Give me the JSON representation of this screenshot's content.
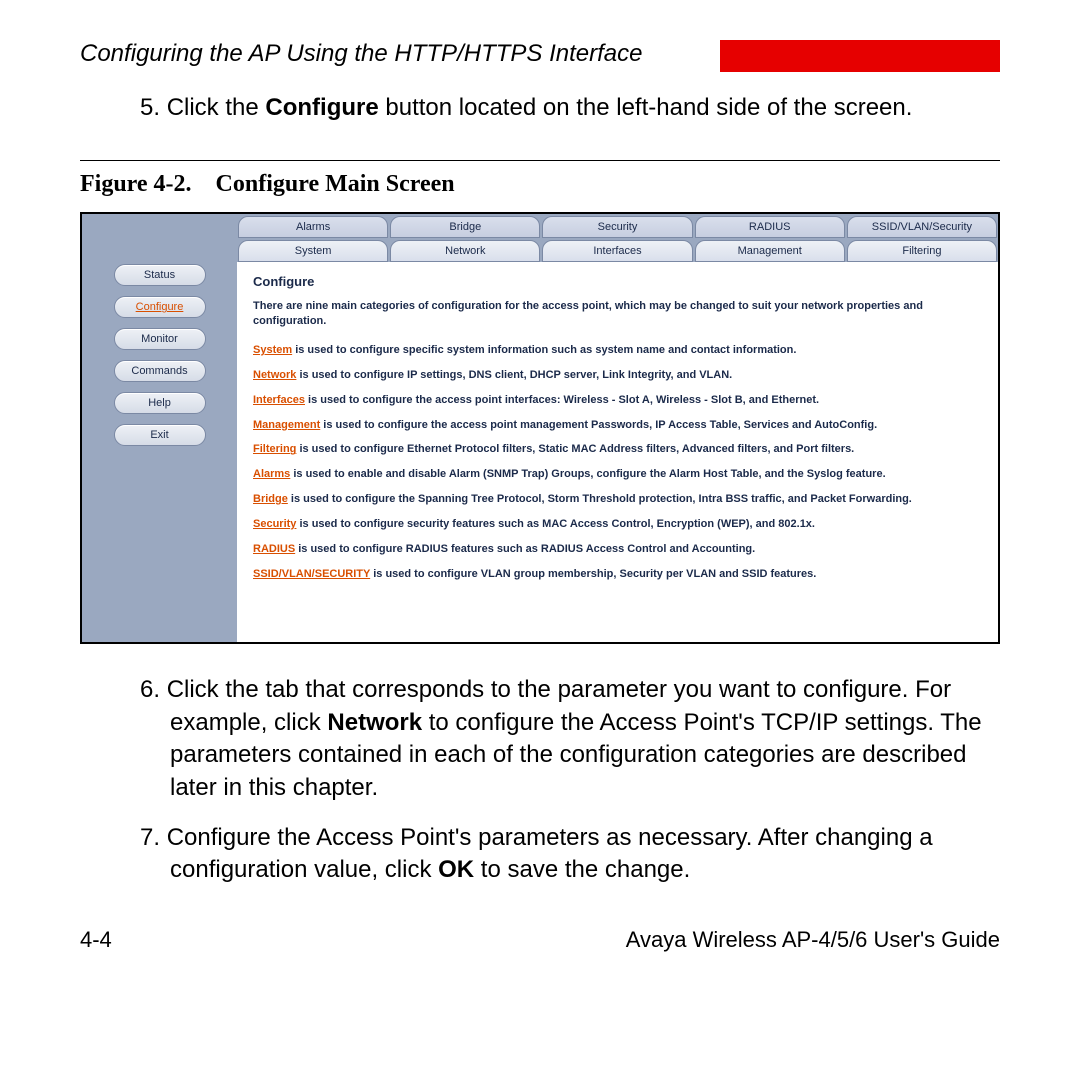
{
  "header": {
    "title": "Configuring the AP Using the HTTP/HTTPS Interface"
  },
  "steps": {
    "s5": {
      "num": "5.",
      "pre": "Click the ",
      "bold": "Configure",
      "post": " button located on the left-hand side of the screen."
    },
    "s6": {
      "num": "6.",
      "pre": "Click the tab that corresponds to the parameter you want to configure. For example, click ",
      "bold": "Network",
      "post": " to configure the Access Point's TCP/IP settings. The parameters contained in each of the configuration categories are described later in this chapter."
    },
    "s7": {
      "num": "7.",
      "pre": "Configure the Access Point's parameters as necessary. After changing a configuration value, click ",
      "bold": "OK",
      "post": " to save the change."
    }
  },
  "figure": {
    "label": "Figure 4-2.",
    "title": "Configure Main Screen"
  },
  "sidebar": {
    "b0": "Status",
    "b1": "Configure",
    "b2": "Monitor",
    "b3": "Commands",
    "b4": "Help",
    "b5": "Exit"
  },
  "tabs": {
    "r1": {
      "t0": "Alarms",
      "t1": "Bridge",
      "t2": "Security",
      "t3": "RADIUS",
      "t4": "SSID/VLAN/Security"
    },
    "r2": {
      "t0": "System",
      "t1": "Network",
      "t2": "Interfaces",
      "t3": "Management",
      "t4": "Filtering"
    }
  },
  "cfg": {
    "title": "Configure",
    "intro": "There are nine main categories of configuration for the access point, which may be changed to suit your network properties and configuration.",
    "items": {
      "i0": {
        "link": "System",
        "text": " is used to configure specific system information such as system name and contact information."
      },
      "i1": {
        "link": "Network",
        "text": " is used to configure IP settings, DNS client, DHCP server, Link Integrity, and VLAN."
      },
      "i2": {
        "link": "Interfaces",
        "text": " is used to configure the access point interfaces: Wireless - Slot A, Wireless - Slot B, and Ethernet."
      },
      "i3": {
        "link": "Management",
        "text": " is used to configure the access point management Passwords, IP Access Table, Services and AutoConfig."
      },
      "i4": {
        "link": "Filtering",
        "text": " is used to configure Ethernet Protocol filters, Static MAC Address filters, Advanced filters, and Port filters."
      },
      "i5": {
        "link": "Alarms",
        "text": " is used to enable and disable Alarm (SNMP Trap) Groups, configure the Alarm Host Table, and the Syslog feature."
      },
      "i6": {
        "link": "Bridge",
        "text": " is used to configure the Spanning Tree Protocol, Storm Threshold protection, Intra BSS traffic, and Packet Forwarding."
      },
      "i7": {
        "link": "Security",
        "text": " is used to configure security features such as MAC Access Control, Encryption (WEP), and 802.1x."
      },
      "i8": {
        "link": "RADIUS",
        "text": " is used to configure RADIUS features such as RADIUS Access Control and Accounting."
      },
      "i9": {
        "link": "SSID/VLAN/SECURITY",
        "text": " is used to configure VLAN group membership, Security per VLAN and SSID features."
      }
    }
  },
  "footer": {
    "left": "4-4",
    "right": "Avaya Wireless AP-4/5/6 User's Guide"
  }
}
